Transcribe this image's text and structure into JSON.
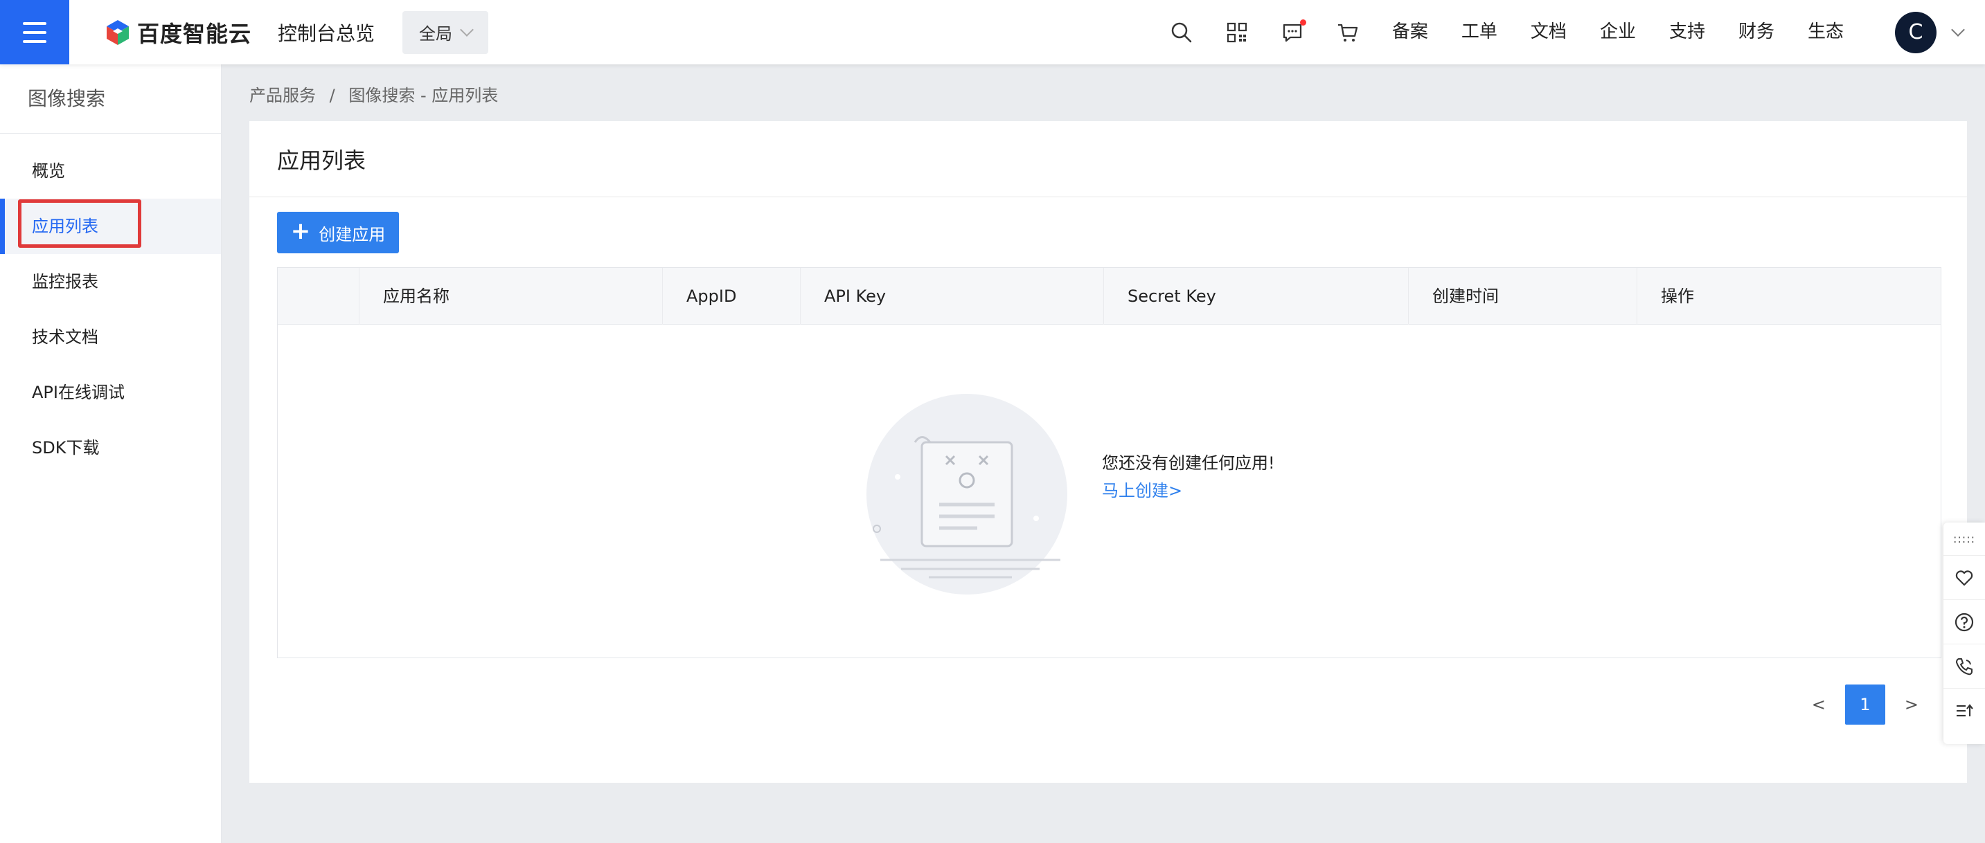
{
  "topbar": {
    "logo_text": "百度智能云",
    "console_title": "控制台总览",
    "region": "全局",
    "nav_links": [
      "备案",
      "工单",
      "文档",
      "企业",
      "支持",
      "财务",
      "生态"
    ],
    "avatar_initial": "C",
    "accent_color": "#2468f2"
  },
  "sidebar": {
    "title": "图像搜索",
    "items": [
      {
        "label": "概览"
      },
      {
        "label": "应用列表"
      },
      {
        "label": "监控报表"
      },
      {
        "label": "技术文档"
      },
      {
        "label": "API在线调试"
      },
      {
        "label": "SDK下载"
      }
    ]
  },
  "breadcrumb": {
    "parent": "产品服务",
    "separator": "/",
    "current": "图像搜索 - 应用列表"
  },
  "main": {
    "title": "应用列表",
    "create_button": "创建应用",
    "table": {
      "columns": [
        "",
        "应用名称",
        "AppID",
        "API Key",
        "Secret Key",
        "创建时间",
        "操作"
      ]
    },
    "empty_state": {
      "message": "您还没有创建任何应用!",
      "link": "马上创建>"
    },
    "pagination": {
      "prev": "<",
      "current_page": "1",
      "next": ">"
    }
  }
}
